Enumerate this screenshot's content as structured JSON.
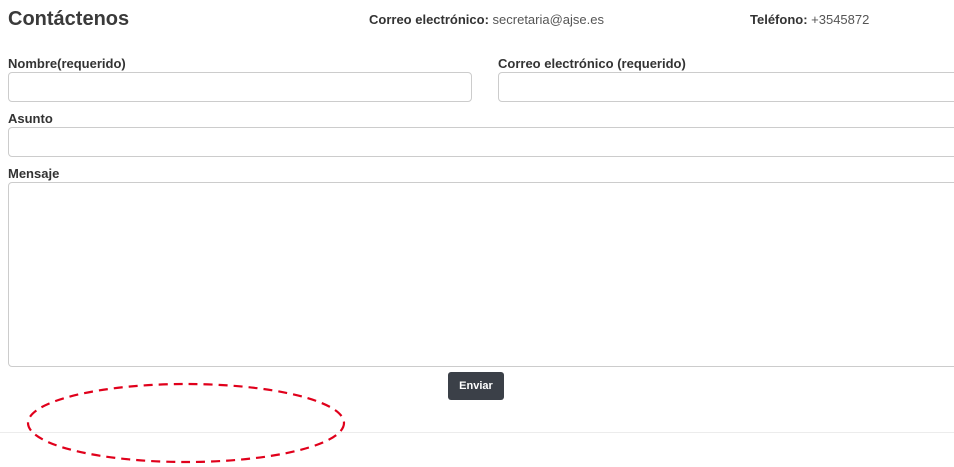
{
  "header": {
    "title": "Contáctenos",
    "email_label": "Correo electrónico:",
    "email_value": " secretaria@ajse.es",
    "phone_label": "Teléfono:",
    "phone_value": " +3545872"
  },
  "form": {
    "nombre_label": "Nombre(requerido)",
    "correo_label": "Correo electrónico (requerido)",
    "asunto_label": "Asunto",
    "mensaje_label": "Mensaje",
    "submit_label": "Enviar"
  },
  "colors": {
    "button_bg": "#3b4048",
    "annotation": "#e0001b",
    "field_border": "#cccccc"
  }
}
